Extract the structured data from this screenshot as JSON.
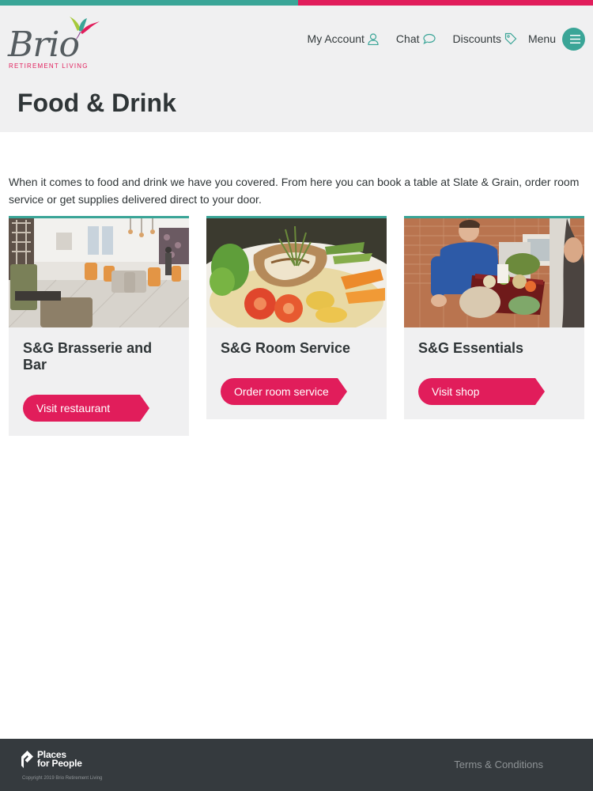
{
  "colors": {
    "teal": "#3aa597",
    "pink": "#e11d5b",
    "header_bg": "#f0f0f1",
    "footer_bg": "#353a3e"
  },
  "brand": {
    "logo_word": "Brio",
    "logo_sub": "RETIREMENT LIVING"
  },
  "nav": {
    "account_label": "My Account",
    "account_icon": "user-icon",
    "chat_label": "Chat",
    "chat_icon": "speech-bubble-icon",
    "discounts_label": "Discounts",
    "discounts_icon": "tag-icon",
    "menu_label": "Menu",
    "menu_icon": "hamburger-icon"
  },
  "page": {
    "title": "Food & Drink",
    "intro": "When it comes to food and drink we have you covered. From here you can book a table at Slate & Grain, order room service or get supplies delivered direct to your door."
  },
  "cards": [
    {
      "title": "S&G Brasserie and Bar",
      "button": "Visit restaurant"
    },
    {
      "title": "S&G Room Service",
      "button": "Order room service"
    },
    {
      "title": "S&G Essentials",
      "button": "Visit shop"
    }
  ],
  "footer": {
    "org_line1": "Places",
    "org_line2": "for People",
    "copyright": "Copyright 2019 Brio Retirement Living",
    "terms": "Terms & Conditions"
  }
}
